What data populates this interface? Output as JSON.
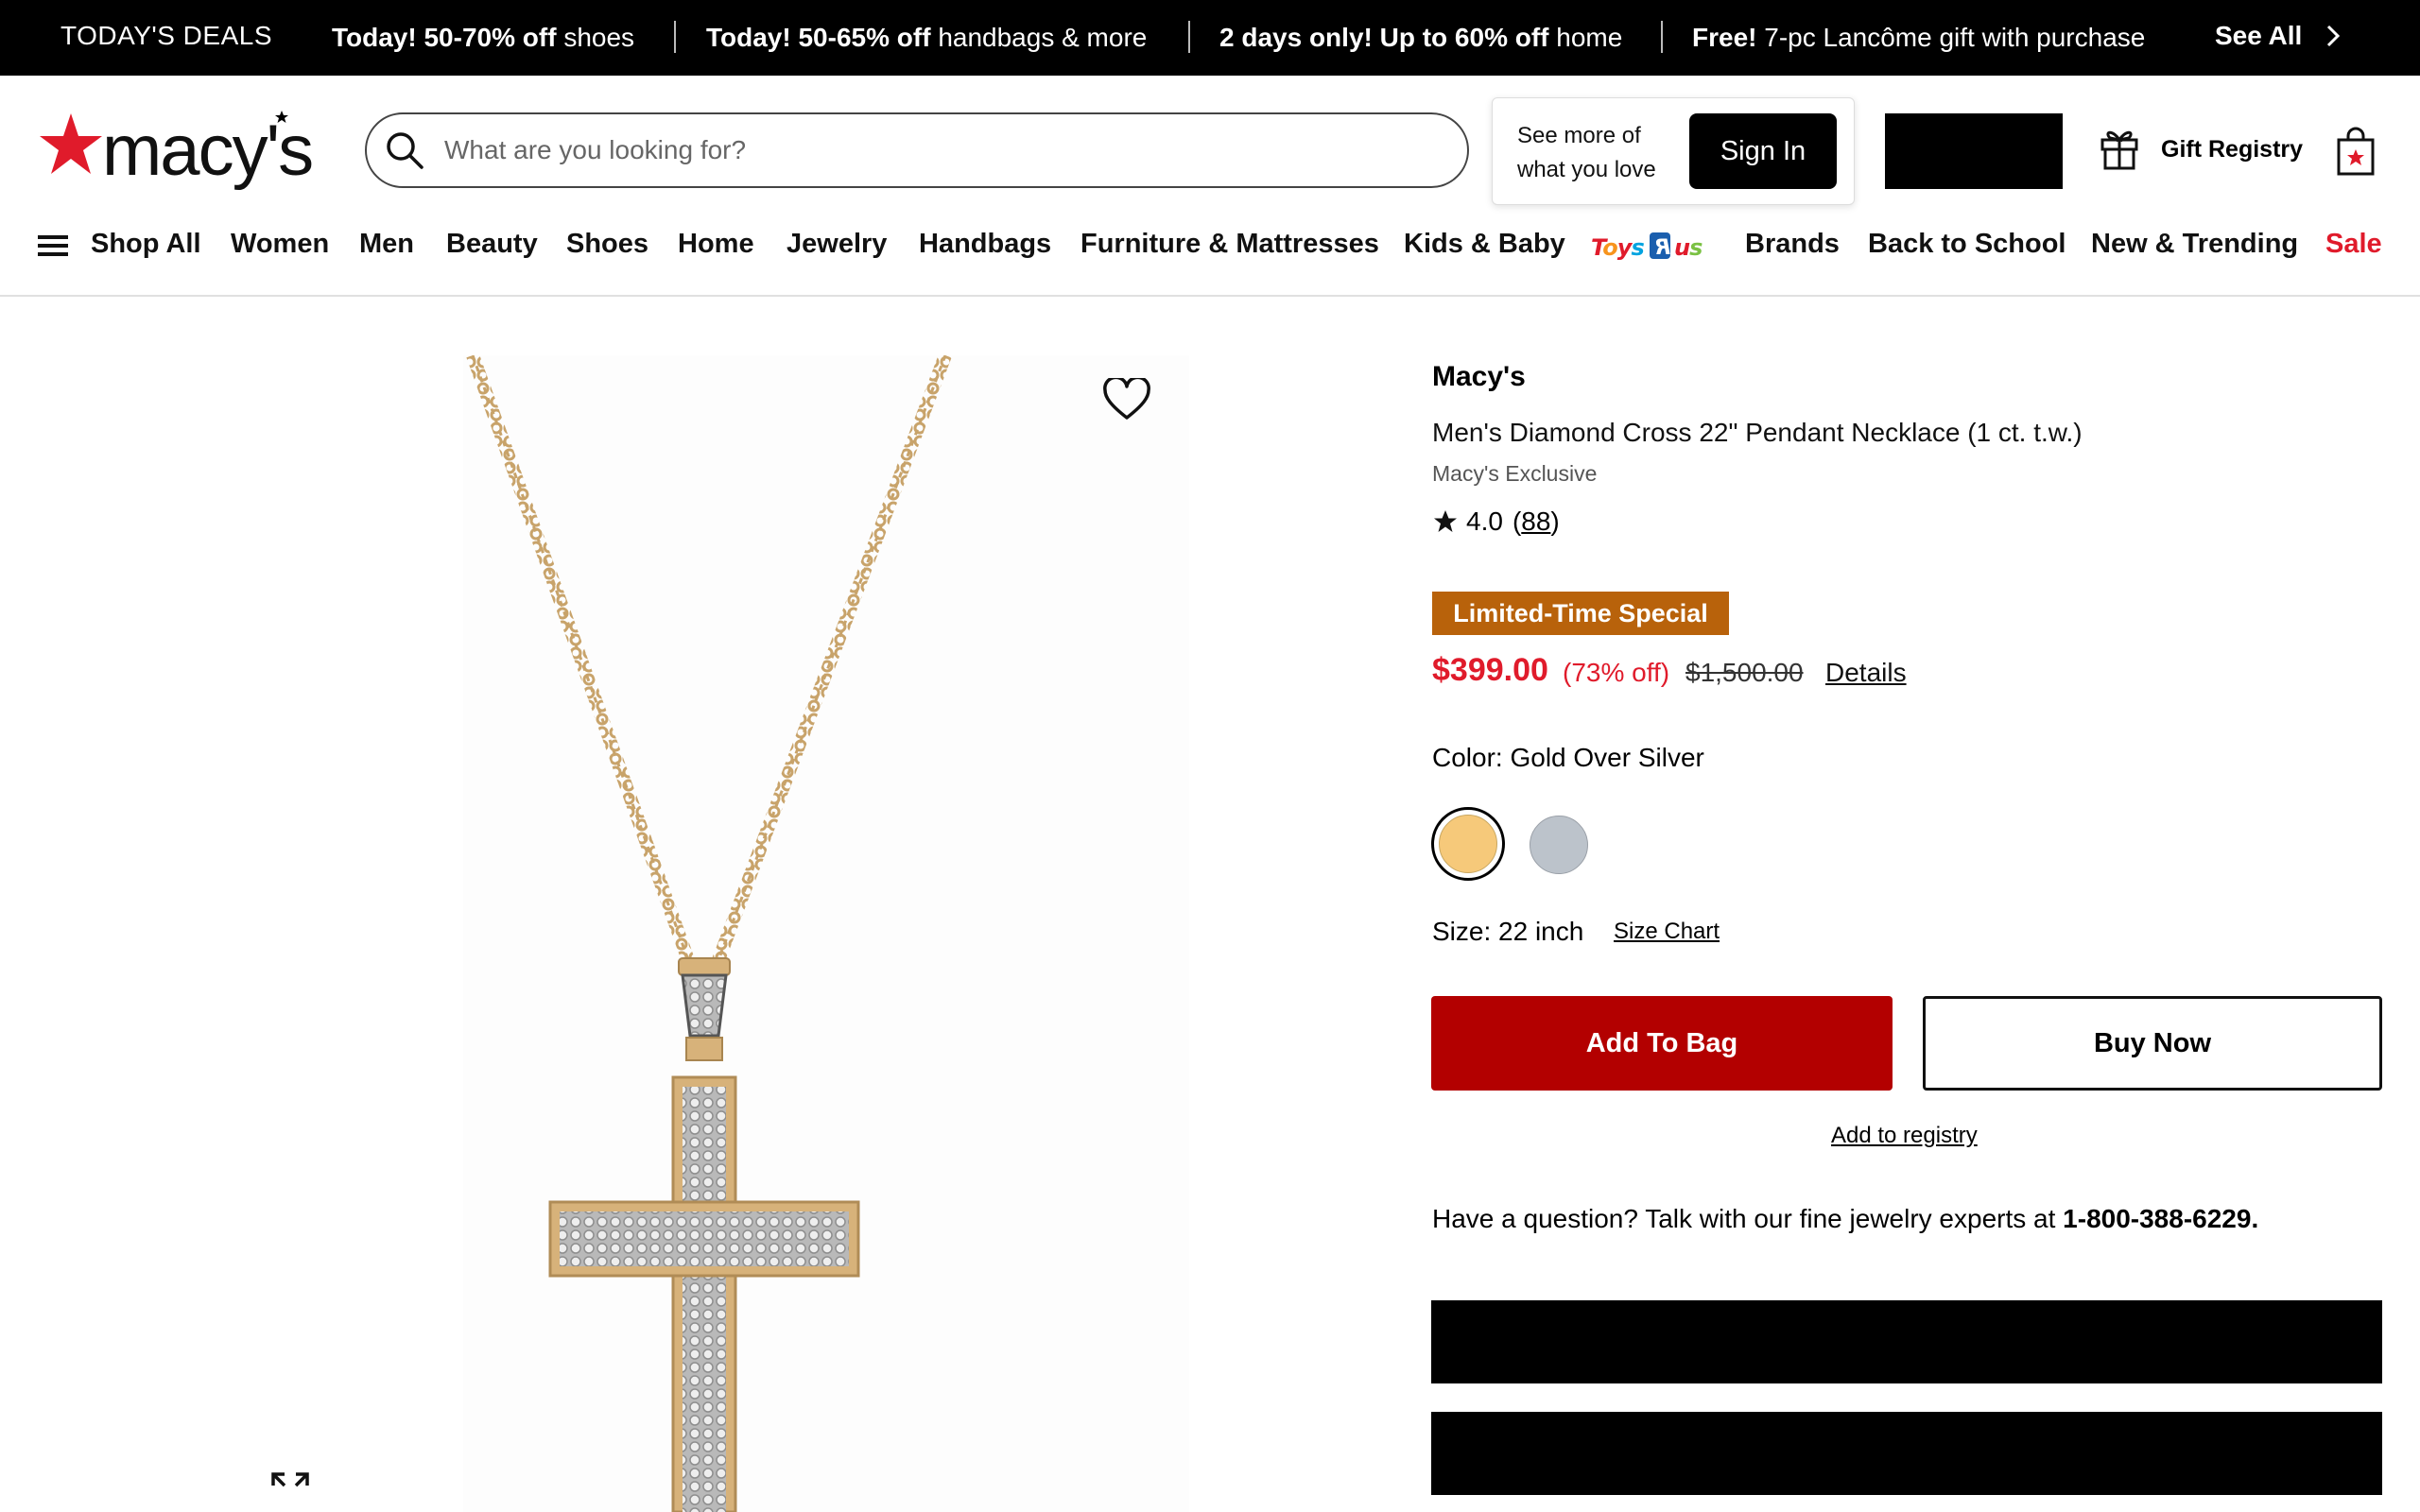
{
  "deals": {
    "label": "TODAY'S DEALS",
    "items": [
      {
        "bold": "Today! 50-70% off",
        "rest": "shoes"
      },
      {
        "bold": "Today! 50-65% off",
        "rest": "handbags & more"
      },
      {
        "bold": "2 days only! Up to 60% off",
        "rest": "home"
      },
      {
        "bold": "Free!",
        "rest": "7-pc Lancôme gift with purchase"
      }
    ],
    "see_all": "See All"
  },
  "header": {
    "logo_text": "macy's",
    "search_placeholder": "What are you looking for?",
    "signin_prompt": "See more of what you love",
    "signin_button": "Sign In",
    "gift_registry": "Gift Registry"
  },
  "nav": {
    "items": [
      "Shop All",
      "Women",
      "Men",
      "Beauty",
      "Shoes",
      "Home",
      "Jewelry",
      "Handbags",
      "Furniture & Mattresses",
      "Kids & Baby",
      "Brands",
      "Back to School",
      "New & Trending",
      "Sale"
    ],
    "toys_logo": "ToysRus"
  },
  "product": {
    "brand": "Macy's",
    "name": "Men's Diamond Cross 22\" Pendant Necklace (1 ct. t.w.)",
    "exclusive": "Macy's Exclusive",
    "rating": "4.0",
    "review_count": "88",
    "badge": "Limited-Time Special",
    "price": "$399.00",
    "percent_off": "(73% off)",
    "original_price": "$1,500.00",
    "details_link": "Details",
    "color_label": "Color: Gold Over Silver",
    "colors": [
      {
        "name": "Gold Over Silver",
        "hex": "#f6c97a",
        "selected": true
      },
      {
        "name": "Silver",
        "hex": "#bcc3cb",
        "selected": false
      }
    ],
    "size_label": "Size: 22 inch",
    "size_chart": "Size Chart",
    "add_to_bag": "Add To Bag",
    "buy_now": "Buy Now",
    "add_to_registry": "Add to registry",
    "question_text": "Have a question? Talk with our fine jewelry experts at",
    "phone": "1-800-388-6229."
  },
  "colors": {
    "accent_red": "#e01b2b",
    "add_to_bag_red": "#b30000",
    "badge_orange": "#b8620b"
  }
}
